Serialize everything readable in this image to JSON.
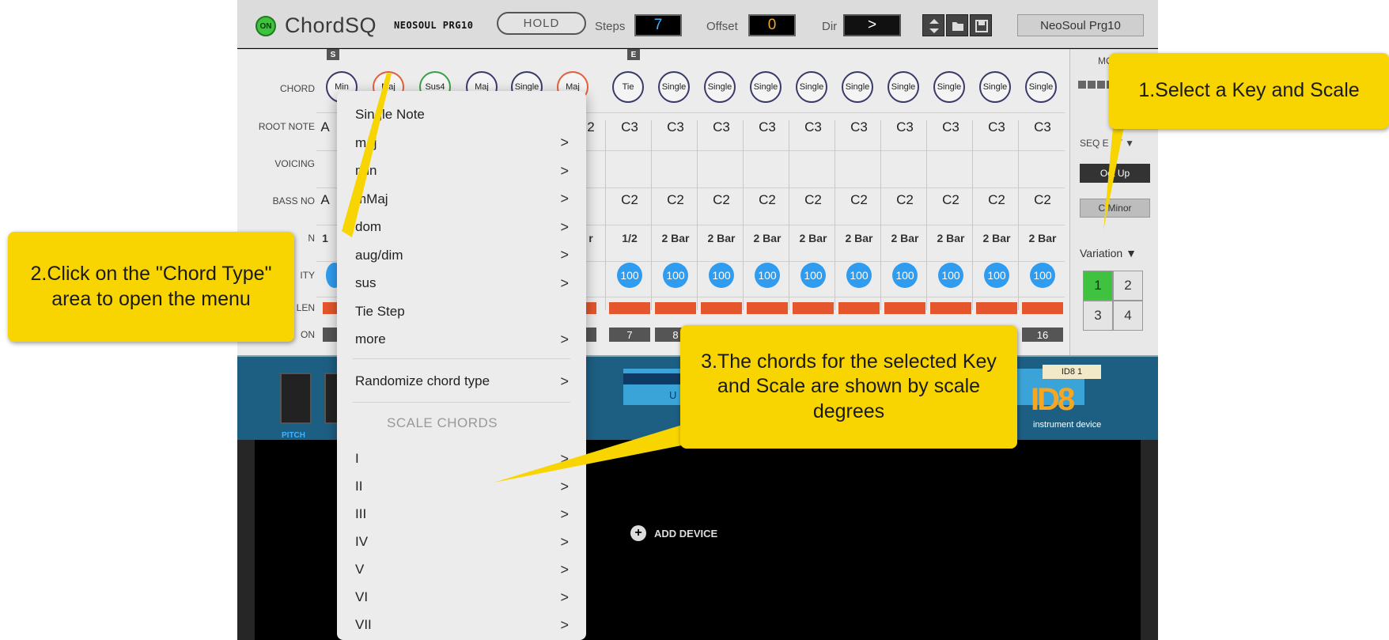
{
  "topbar": {
    "on_label": "ON",
    "title": "ChordSQ",
    "preset_script": "NEOSOUL PRG10",
    "hold_label": "HOLD",
    "steps_label": "Steps",
    "steps_value": "7",
    "offset_label": "Offset",
    "offset_value": "0",
    "dir_label": "Dir",
    "dir_value": ">",
    "preset_name": "NeoSoul Prg10"
  },
  "seq": {
    "markers": {
      "start": "S",
      "end": "E"
    },
    "row_labels": {
      "chord": "CHORD",
      "root": "ROOT NOTE",
      "voicing": "VOICING",
      "bass": "BASS NO",
      "len": "N",
      "velocity": "ITY",
      "len2": "LEN",
      "step": "ON"
    },
    "first_cols": {
      "chords": [
        "Min",
        "Maj",
        "Sus4",
        "Maj",
        "Single",
        "Maj"
      ],
      "root_a": "A",
      "bass_a": "A",
      "len_1": "1",
      "len_r": "r",
      "root_partial": "2"
    },
    "columns": [
      {
        "chord": "Tie",
        "root": "C3",
        "bass": "C2",
        "len": "1/2",
        "vel": "100",
        "step": "7"
      },
      {
        "chord": "Single",
        "root": "C3",
        "bass": "C2",
        "len": "2 Bar",
        "vel": "100",
        "step": "8"
      },
      {
        "chord": "Single",
        "root": "C3",
        "bass": "C2",
        "len": "2 Bar",
        "vel": "100",
        "step": ""
      },
      {
        "chord": "Single",
        "root": "C3",
        "bass": "C2",
        "len": "2 Bar",
        "vel": "100",
        "step": ""
      },
      {
        "chord": "Single",
        "root": "C3",
        "bass": "C2",
        "len": "2 Bar",
        "vel": "100",
        "step": ""
      },
      {
        "chord": "Single",
        "root": "C3",
        "bass": "C2",
        "len": "2 Bar",
        "vel": "100",
        "step": ""
      },
      {
        "chord": "Single",
        "root": "C3",
        "bass": "C2",
        "len": "2 Bar",
        "vel": "100",
        "step": ""
      },
      {
        "chord": "Single",
        "root": "C3",
        "bass": "C2",
        "len": "2 Bar",
        "vel": "100",
        "step": ""
      },
      {
        "chord": "Single",
        "root": "C3",
        "bass": "C2",
        "len": "2 Bar",
        "vel": "100",
        "step": ""
      },
      {
        "chord": "Single",
        "root": "C3",
        "bass": "C2",
        "len": "2 Bar",
        "vel": "100",
        "step": "16"
      }
    ]
  },
  "right_panel": {
    "mode_label": "MC",
    "seq_edit_label": "SEQ E",
    "seq_edit_tail": "T ▼",
    "oct_up": "Oct Up",
    "c_minor": "C Minor",
    "variation_label": "Variation ▼",
    "variations": [
      "1",
      "2",
      "3",
      "4"
    ]
  },
  "rack": {
    "pitch_label": "PITCH",
    "display_text": "U",
    "logo": "ID8",
    "logo_sub": "instrument device",
    "tag": "ID8 1"
  },
  "add_device": "ADD DEVICE",
  "menu": {
    "items": [
      {
        "label": "Single Note",
        "arrow": ""
      },
      {
        "label": "maj",
        "arrow": ">"
      },
      {
        "label": "min",
        "arrow": ">"
      },
      {
        "label": "mMaj",
        "arrow": ">"
      },
      {
        "label": "dom",
        "arrow": ">"
      },
      {
        "label": "aug/dim",
        "arrow": ">"
      },
      {
        "label": "sus",
        "arrow": ">"
      },
      {
        "label": "Tie Step",
        "arrow": ""
      },
      {
        "label": "more",
        "arrow": ">"
      }
    ],
    "randomize": {
      "label": "Randomize chord type",
      "arrow": ">"
    },
    "scale_header": "SCALE CHORDS",
    "scale_items": [
      {
        "label": "I",
        "arrow": ">"
      },
      {
        "label": "II",
        "arrow": ">"
      },
      {
        "label": "III",
        "arrow": ">"
      },
      {
        "label": "IV",
        "arrow": ">"
      },
      {
        "label": "V",
        "arrow": ">"
      },
      {
        "label": "VI",
        "arrow": ">"
      },
      {
        "label": "VII",
        "arrow": ">"
      }
    ]
  },
  "callouts": {
    "one": "1.Select a Key and Scale",
    "two": "2.Click on the \"Chord Type\" area to open the menu",
    "three": "3.The chords for the selected Key and Scale are shown by scale degrees"
  },
  "colors": {
    "callout": "#f8d500",
    "accent_blue": "#3fb3ff",
    "velocity": "#2f9cf0",
    "len_bar": "#e5562c",
    "on_green": "#3fc23f"
  }
}
